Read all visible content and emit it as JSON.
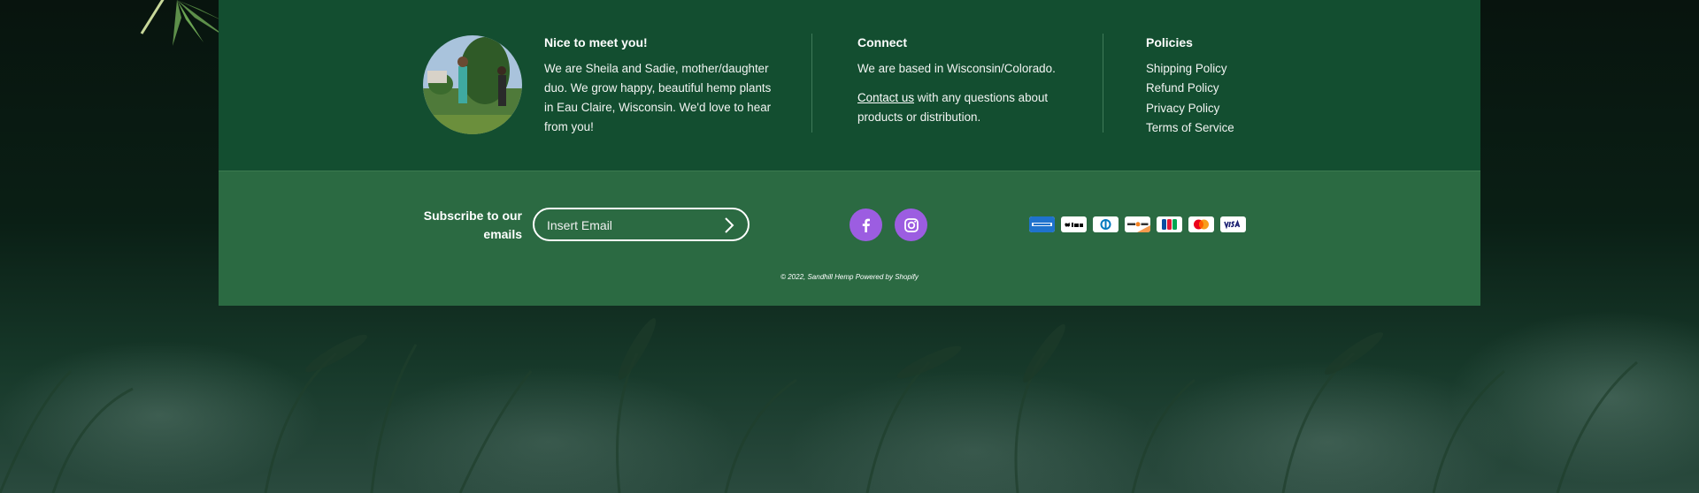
{
  "about": {
    "title": "Nice to meet you!",
    "text": "We are Sheila and Sadie, mother/daughter duo. We grow happy, beautiful hemp plants in Eau Claire, Wisconsin. We'd love to hear from you!"
  },
  "connect": {
    "title": "Connect",
    "location": "We are based in Wisconsin/Colorado.",
    "contact_link": "Contact us",
    "contact_rest": " with any questions about products or distribution."
  },
  "policies": {
    "title": "Policies",
    "items": [
      "Shipping Policy",
      "Refund Policy",
      "Privacy Policy",
      "Terms of Service"
    ]
  },
  "subscribe": {
    "label": "Subscribe to our emails",
    "placeholder": "Insert Email"
  },
  "social": {
    "facebook_icon": "facebook-icon",
    "instagram_icon": "instagram-icon",
    "color": "#9c5de1"
  },
  "payments": [
    "American Express",
    "Apple Pay",
    "Diners Club",
    "Discover",
    "JCB",
    "Mastercard",
    "Visa"
  ],
  "copyright": "© 2022, Sandhill Hemp Powered by Shopify",
  "colors": {
    "footer_top": "#134e30",
    "footer_bottom": "#2b6a42"
  }
}
